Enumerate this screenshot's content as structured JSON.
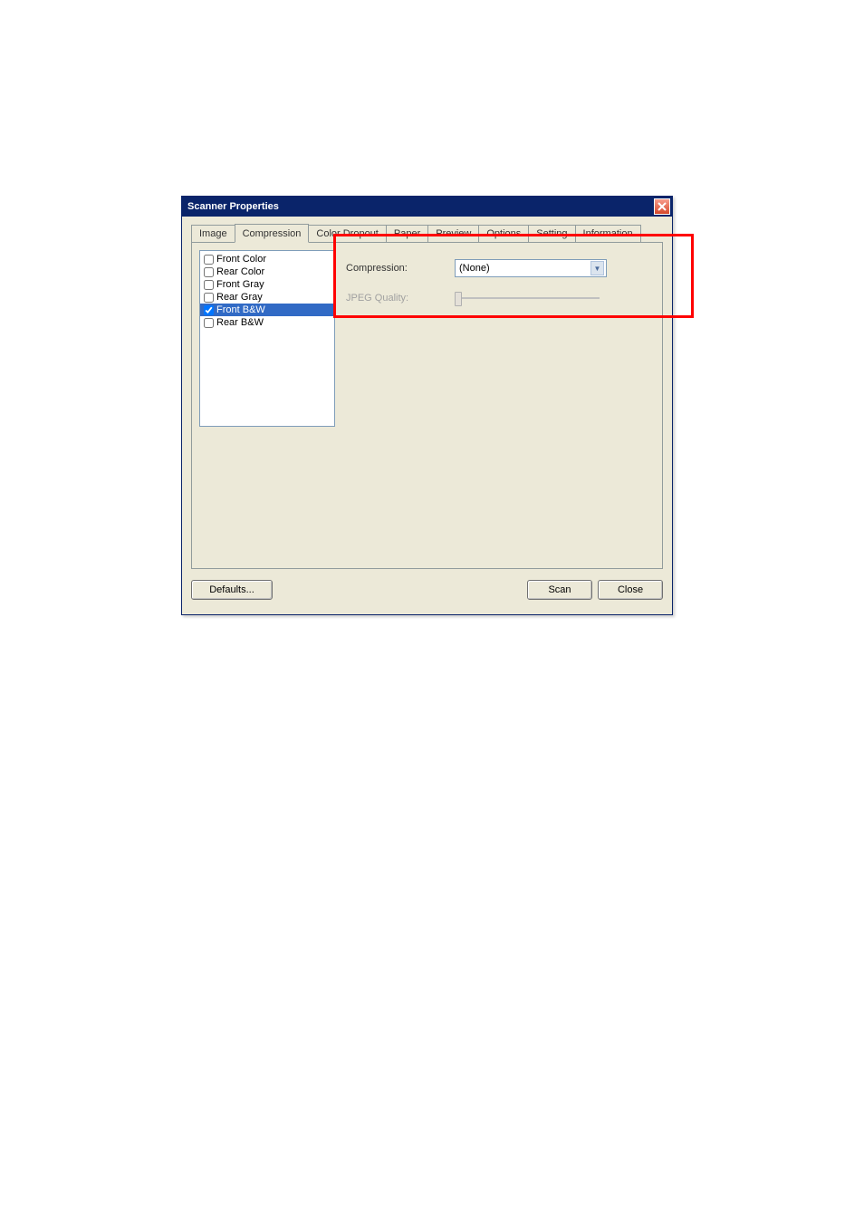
{
  "window": {
    "title": "Scanner Properties"
  },
  "tabs": {
    "t0": "Image",
    "t1": "Compression",
    "t2": "Color Dropout",
    "t3": "Paper",
    "t4": "Preview",
    "t5": "Options",
    "t6": "Setting",
    "t7": "Information"
  },
  "list": {
    "i0": "Front Color",
    "i1": "Rear Color",
    "i2": "Front Gray",
    "i3": "Rear Gray",
    "i4": "Front B&W",
    "i5": "Rear B&W"
  },
  "form": {
    "compression_label": "Compression:",
    "compression_value": "(None)",
    "jpeg_label": "JPEG Quality:"
  },
  "buttons": {
    "defaults": "Defaults...",
    "scan": "Scan",
    "close": "Close"
  }
}
